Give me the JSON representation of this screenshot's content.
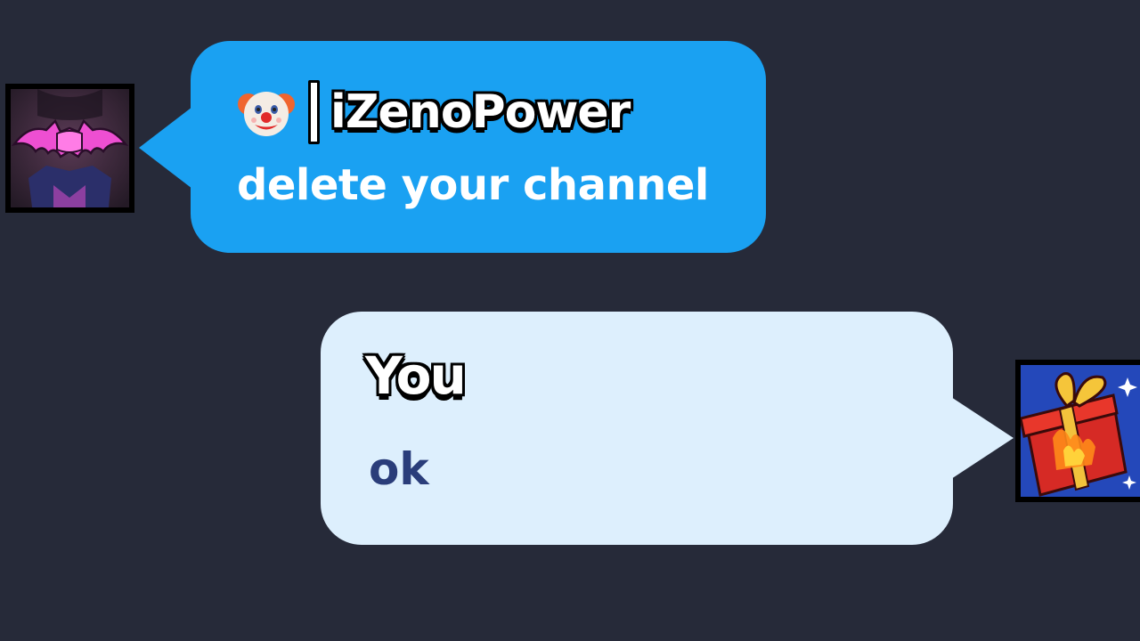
{
  "colors": {
    "background": "#262a39",
    "incoming_bubble": "#1aa1f2",
    "outgoing_bubble": "#ddeffd",
    "outgoing_text": "#2a3d7a"
  },
  "messages": [
    {
      "direction": "incoming",
      "avatar_icon": "pink-bat-mask-icon",
      "badge_icon": "clown-face-icon",
      "sender": "iZenoPower",
      "text": "delete your channel"
    },
    {
      "direction": "outgoing",
      "avatar_icon": "gift-box-icon",
      "sender": "You",
      "text": "ok"
    }
  ]
}
